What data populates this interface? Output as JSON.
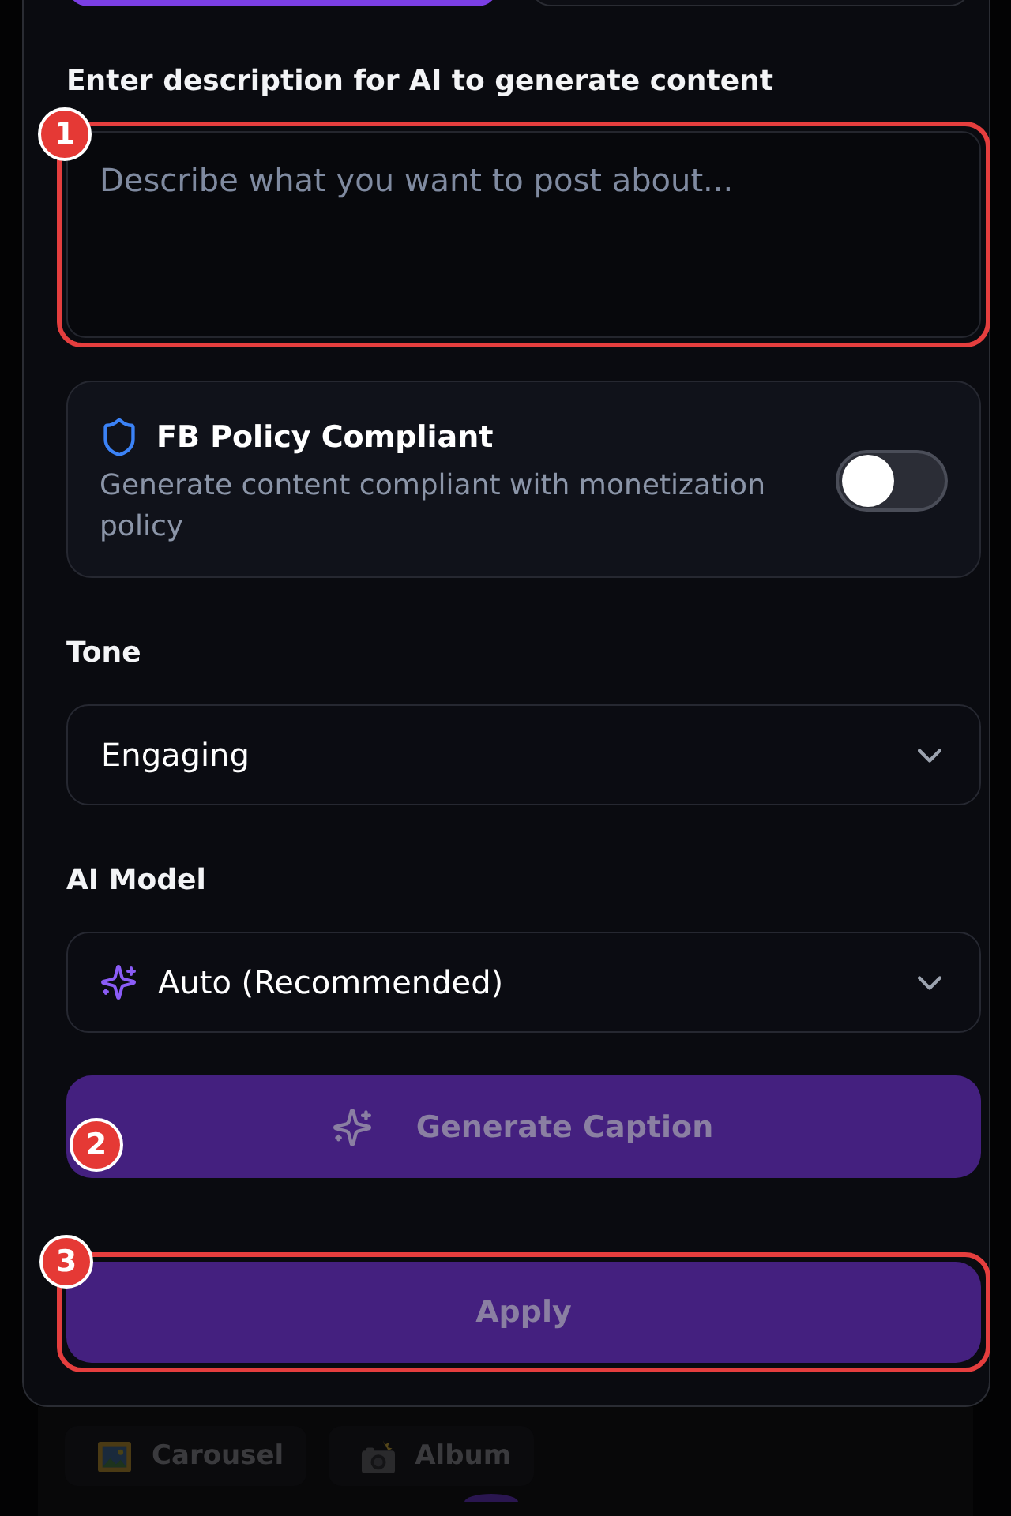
{
  "top_buttons": [
    {
      "selected": true
    },
    {
      "selected": false
    }
  ],
  "description": {
    "label": "Enter description for AI to generate content",
    "placeholder": "Describe what you want to post about...",
    "callout": {
      "number": "1",
      "outlined": true
    }
  },
  "policy": {
    "title": "FB Policy Compliant",
    "description": "Generate content compliant with monetization policy",
    "on": false
  },
  "tone": {
    "label": "Tone",
    "value": "Engaging"
  },
  "ai_model": {
    "label": "AI Model",
    "value": "Auto (Recommended)"
  },
  "generate_button": {
    "label": "Generate Caption",
    "disabled": true,
    "callout": {
      "number": "2"
    }
  },
  "apply_button": {
    "label": "Apply",
    "disabled": true,
    "callout": {
      "number": "3",
      "outlined": true
    }
  },
  "background_tabs": [
    {
      "kind": "carousel",
      "label": "Carousel"
    },
    {
      "kind": "album",
      "label": "Album"
    }
  ]
}
